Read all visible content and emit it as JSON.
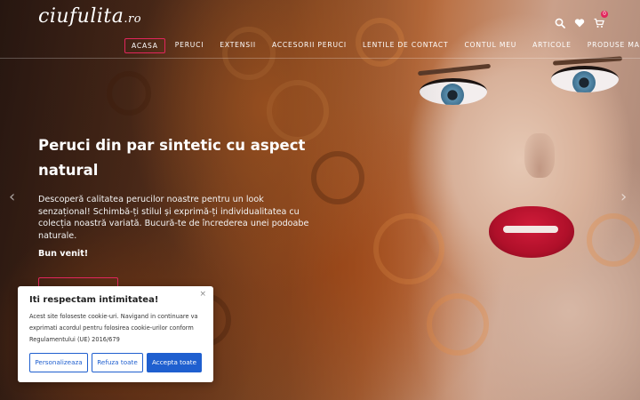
{
  "header": {
    "logo_main": "ciufulita",
    "logo_tld": ".ro",
    "cart_count": "0",
    "icons": [
      "search-icon",
      "heart-icon",
      "cart-icon"
    ]
  },
  "nav": {
    "items": [
      {
        "label": "ACASA",
        "active": true
      },
      {
        "label": "PERUCI"
      },
      {
        "label": "EXTENSII"
      },
      {
        "label": "ACCESORII PERUCI"
      },
      {
        "label": "LENTILE DE CONTACT"
      },
      {
        "label": "CONTUL MEU"
      },
      {
        "label": "ARTICOLE"
      },
      {
        "label": "PRODUSE MAKE-UP"
      }
    ]
  },
  "hero": {
    "title": "Peruci din par sintetic cu aspect natural",
    "description": "Descoperă calitatea perucilor noastre pentru un look senzațional! Schimbă-ți stilul și exprimă-ți individualitatea cu colecția noastră variată. Bucură-te de încrederea unei podoabe naturale.",
    "welcome": "Bun venit!",
    "prev_arrow": "‹",
    "next_arrow": "›"
  },
  "cookie": {
    "title": "Iti respectam intimitatea!",
    "close": "×",
    "text": "Acest site foloseste cookie-uri. Navigand in continuare va exprimati acordul pentru folosirea cookie-urilor conform Regulamentului (UE) 2016/679",
    "customize": "Personalizeaza",
    "reject": "Refuza toate",
    "accept": "Accepta toate"
  },
  "colors": {
    "accent": "#e2265c",
    "button_blue": "#1f5fcf"
  }
}
